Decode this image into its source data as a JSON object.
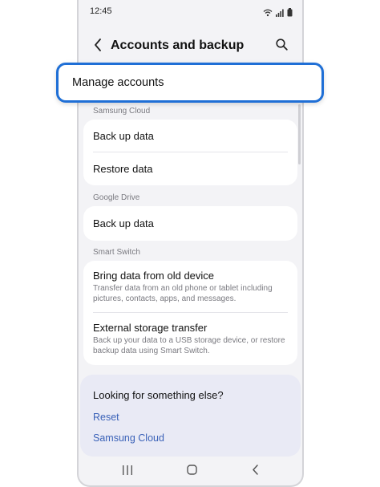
{
  "status_bar": {
    "time": "12:45",
    "icons": [
      "wifi-icon",
      "signal-icon",
      "battery-icon"
    ]
  },
  "header": {
    "title": "Accounts and backup",
    "back_icon": "chevron-left-icon",
    "search_icon": "search-icon"
  },
  "highlighted_item": {
    "label": "Manage accounts"
  },
  "sections": [
    {
      "label": "Samsung Cloud",
      "items": [
        {
          "title": "Back up data"
        },
        {
          "title": "Restore data"
        }
      ]
    },
    {
      "label": "Google Drive",
      "items": [
        {
          "title": "Back up data"
        }
      ]
    },
    {
      "label": "Smart Switch",
      "items": [
        {
          "title": "Bring data from old device",
          "description": "Transfer data from an old phone or tablet including pictures, contacts, apps, and messages."
        },
        {
          "title": "External storage transfer",
          "description": "Back up your data to a USB storage device, or restore backup data using Smart Switch."
        }
      ]
    }
  ],
  "help": {
    "title": "Looking for something else?",
    "links": [
      "Reset",
      "Samsung Cloud"
    ]
  },
  "nav_bar": {
    "icons": [
      "recents-icon",
      "home-icon",
      "back-icon"
    ]
  },
  "colors": {
    "accent": "#1f6fd6",
    "link": "#3b62b8",
    "background": "#f3f3f6",
    "help_background": "#e9eaf5"
  }
}
